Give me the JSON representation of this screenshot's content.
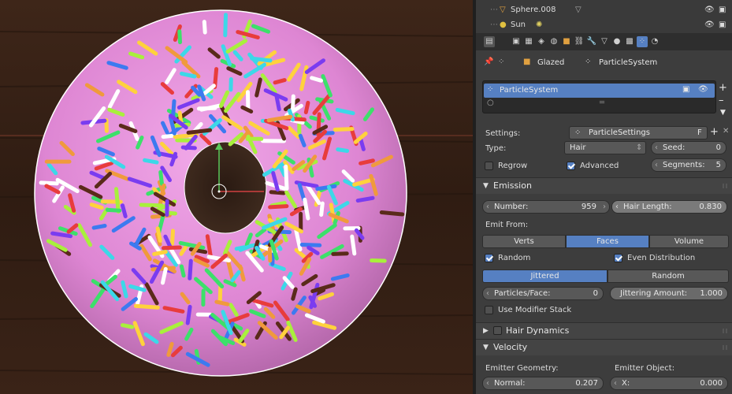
{
  "outliner": {
    "rows": [
      {
        "name": "Sphere.008"
      },
      {
        "name": "Sun"
      }
    ]
  },
  "breadcrumb": {
    "object": "Glazed",
    "system": "ParticleSystem"
  },
  "particle_list": {
    "selected": "ParticleSystem"
  },
  "settings": {
    "settings_label": "Settings:",
    "settings_value": "ParticleSettings",
    "fake_user": "F",
    "type_label": "Type:",
    "type_value": "Hair",
    "seed_label": "Seed:",
    "seed_value": "0",
    "regrow_label": "Regrow",
    "advanced_label": "Advanced",
    "segments_label": "Segments:",
    "segments_value": "5"
  },
  "emission": {
    "title": "Emission",
    "number_label": "Number:",
    "number_value": "959",
    "hair_length_label": "Hair Length:",
    "hair_length_value": "0.830",
    "emit_from_label": "Emit From:",
    "emit_from_options": [
      "Verts",
      "Faces",
      "Volume"
    ],
    "emit_from_selected": "Faces",
    "random_label": "Random",
    "even_distribution_label": "Even Distribution",
    "distribution_options": [
      "Jittered",
      "Random"
    ],
    "distribution_selected": "Jittered",
    "particles_face_label": "Particles/Face:",
    "particles_face_value": "0",
    "jittering_label": "Jittering Amount:",
    "jittering_value": "1.000",
    "modifier_stack_label": "Use Modifier Stack"
  },
  "hair_dynamics": {
    "title": "Hair Dynamics"
  },
  "velocity": {
    "title": "Velocity",
    "emitter_geometry_label": "Emitter Geometry:",
    "emitter_object_label": "Emitter Object:",
    "normal_label": "Normal:",
    "normal_value": "0.207",
    "x_label": "X:",
    "x_value": "0.000"
  },
  "colors": {
    "accent": "#5680c2",
    "frosting": "#e08ad6",
    "wood": "#3a2418"
  }
}
